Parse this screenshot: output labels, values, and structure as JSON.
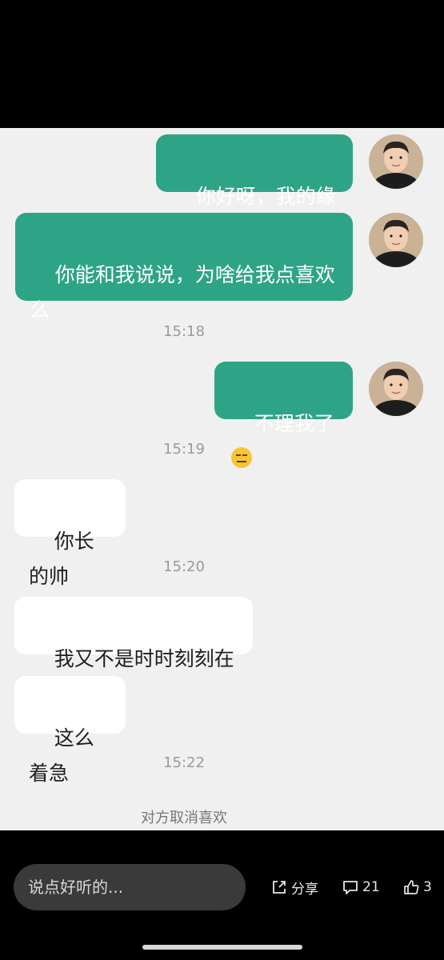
{
  "messages": [
    {
      "text": "你好呀，我的缘分"
    },
    {
      "text": "你能和我说说，为啥给我点喜欢\n么"
    },
    {
      "text": "不理我了",
      "emoji": "expressionless-face"
    },
    {
      "text": "你长的帅"
    },
    {
      "text": "我又不是时时刻刻在线"
    },
    {
      "text": "这么着急"
    }
  ],
  "timestamps": [
    "15:18",
    "15:19",
    "15:20",
    "15:22"
  ],
  "system_note": "对方取消喜欢",
  "composer": {
    "placeholder": "说点好听的..."
  },
  "actions": {
    "share_label": "分享",
    "comment_count": "21",
    "like_count": "3"
  },
  "colors": {
    "my_bubble": "#2ea487",
    "their_bubble": "#ffffff",
    "chat_bg": "#f0f0f0"
  }
}
